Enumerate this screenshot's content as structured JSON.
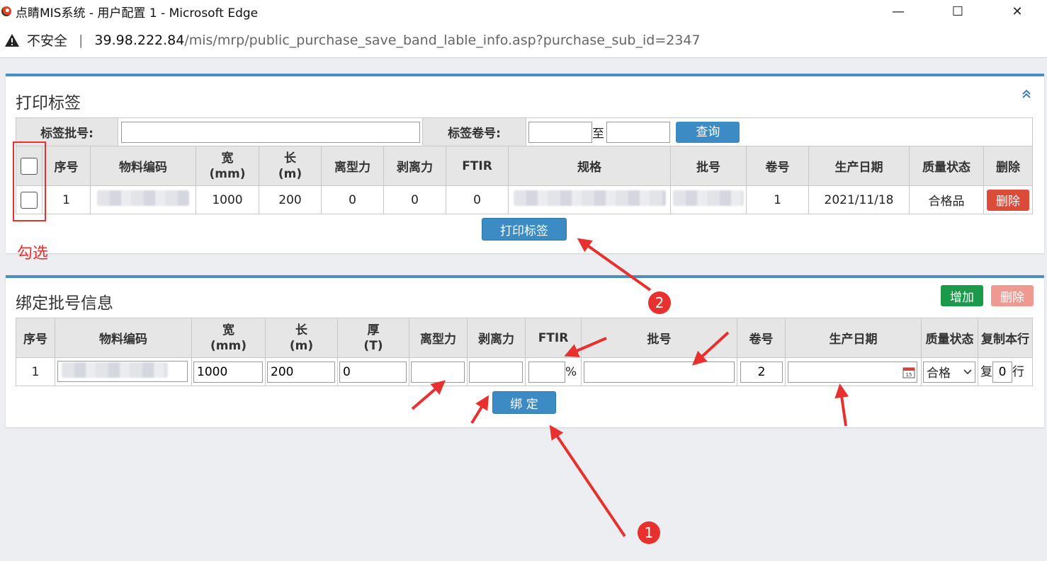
{
  "window": {
    "title": "点睛MIS系统 - 用户配置 1 - Microsoft Edge",
    "minimize": "—",
    "maximize": "☐",
    "close": "✕"
  },
  "address": {
    "insecure_label": "不安全",
    "separator": "|",
    "host": "39.98.222.84",
    "path": "/mis/mrp/public_purchase_save_band_lable_info.asp?purchase_sub_id=2347"
  },
  "print_panel": {
    "title": "打印标签",
    "batch_label": "标签批号:",
    "batch_value": "",
    "roll_label": "标签卷号:",
    "roll_from": "",
    "to_label": "至",
    "roll_to": "",
    "query_button": "查询",
    "headers": [
      "序号",
      "物料编码",
      "宽\n(mm)",
      "长\n(m)",
      "离型力",
      "剥离力",
      "FTIR",
      "规格",
      "批号",
      "卷号",
      "生产日期",
      "质量状态",
      "删除"
    ],
    "row": {
      "seq": "1",
      "width": "1000",
      "length": "200",
      "release_force": "0",
      "peel_force": "0",
      "ftir": "0",
      "roll": "1",
      "date": "2021/11/18",
      "quality": "合格品",
      "delete": "删除"
    },
    "print_button": "打印标签"
  },
  "bind_panel": {
    "title": "绑定批号信息",
    "add_button": "增加",
    "delete_button": "删除",
    "headers": [
      "序号",
      "物料编码",
      "宽\n(mm)",
      "长\n(m)",
      "厚\n(T)",
      "离型力",
      "剥离力",
      "FTIR",
      "批号",
      "卷号",
      "生产日期",
      "质量状态",
      "复制本行"
    ],
    "row": {
      "seq": "1",
      "width": "1000",
      "length": "200",
      "thickness": "0",
      "release_force": "",
      "peel_force": "",
      "ftir": "",
      "percent": "%",
      "batch": "",
      "roll": "2",
      "date": "",
      "quality": "合格",
      "copy_label": "复",
      "copy_count": "0",
      "copy_suffix": "行"
    },
    "bind_button": "绑 定"
  },
  "annotations": {
    "check_label": "勾选",
    "step1": "1",
    "step2": "2",
    "color": "#e8302e"
  }
}
